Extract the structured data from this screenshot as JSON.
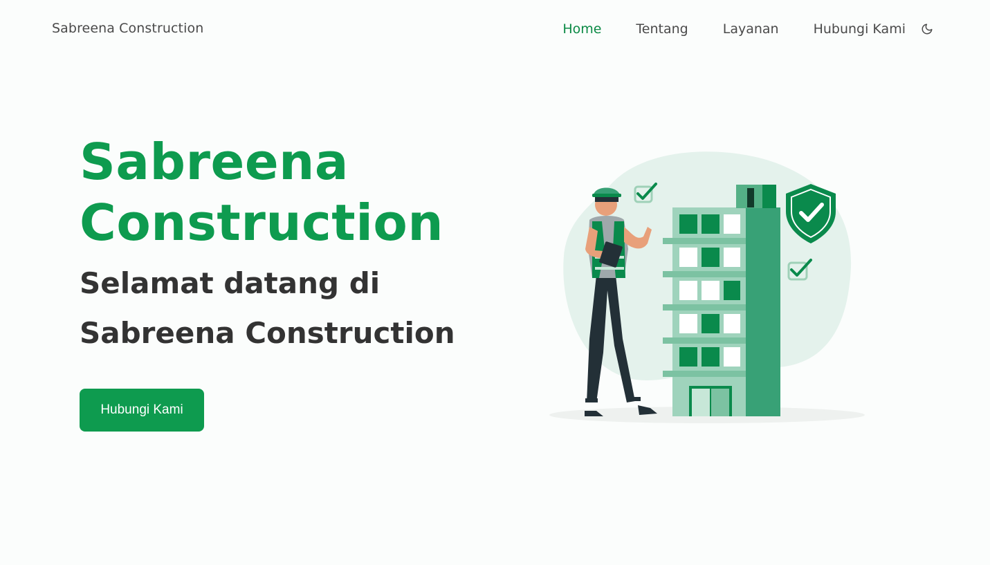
{
  "header": {
    "brand": "Sabreena Construction",
    "nav": [
      {
        "label": "Home",
        "active": true
      },
      {
        "label": "Tentang",
        "active": false
      },
      {
        "label": "Layanan",
        "active": false
      },
      {
        "label": "Hubungi Kami",
        "active": false
      }
    ],
    "theme_toggle_icon": "moon-icon"
  },
  "hero": {
    "title_line1": "Sabreena",
    "title_line2": "Construction",
    "subtitle_line1": "Selamat datang di",
    "subtitle_line2": "Sabreena Construction",
    "button_label": "Hubungi Kami"
  },
  "colors": {
    "accent": "#0e9b4f",
    "active_nav": "#0b8a45",
    "background": "#fbfdfc",
    "text": "#333333"
  }
}
